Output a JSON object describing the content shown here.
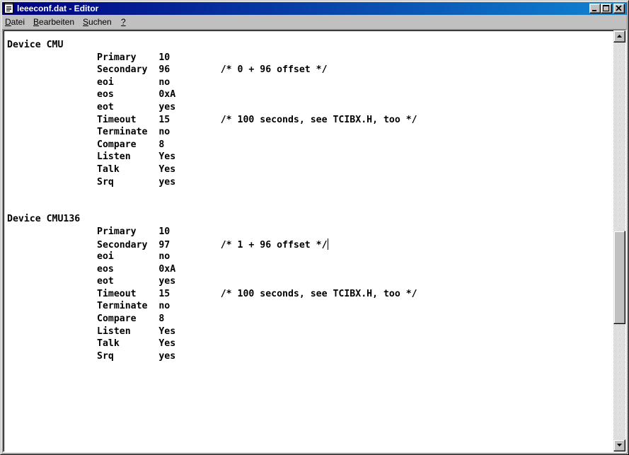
{
  "window": {
    "title": "leeeconf.dat - Editor",
    "icon": "notepad-icon",
    "controls": [
      "minimize-icon",
      "maximize-icon",
      "close-icon"
    ]
  },
  "menu": [
    {
      "label": "Datei",
      "accel": "D",
      "rest": "atei"
    },
    {
      "label": "Bearbeiten",
      "accel": "B",
      "rest": "earbeiten"
    },
    {
      "label": "Suchen",
      "accel": "S",
      "rest": "uchen"
    },
    {
      "label": "?",
      "accel": "?",
      "rest": ""
    }
  ],
  "document": {
    "lines": [
      "Device CMU",
      "                Primary    10",
      "                Secondary  96         /* 0 + 96 offset */",
      "                eoi        no",
      "                eos        0xA",
      "                eot        yes",
      "                Timeout    15         /* 100 seconds, see TCIBX.H, too */",
      "                Terminate  no",
      "                Compare    8",
      "                Listen     Yes",
      "                Talk       Yes",
      "                Srq        yes",
      "",
      "",
      "Device CMU136",
      "                Primary    10",
      "                Secondary  97         /* 1 + 96 offset */",
      "                eoi        no",
      "                eos        0xA",
      "                eot        yes",
      "                Timeout    15         /* 100 seconds, see TCIBX.H, too */",
      "                Terminate  no",
      "                Compare    8",
      "                Listen     Yes",
      "                Talk       Yes",
      "                Srq        yes"
    ],
    "caret_line": 16
  },
  "scrollbar": {
    "up_icon": "scroll-up-arrow-icon",
    "down_icon": "scroll-down-arrow-icon",
    "position": 0.62
  },
  "colors": {
    "titlebar_start": "#000080",
    "titlebar_end": "#1084d0",
    "face": "#c0c0c0",
    "text": "#000000"
  }
}
